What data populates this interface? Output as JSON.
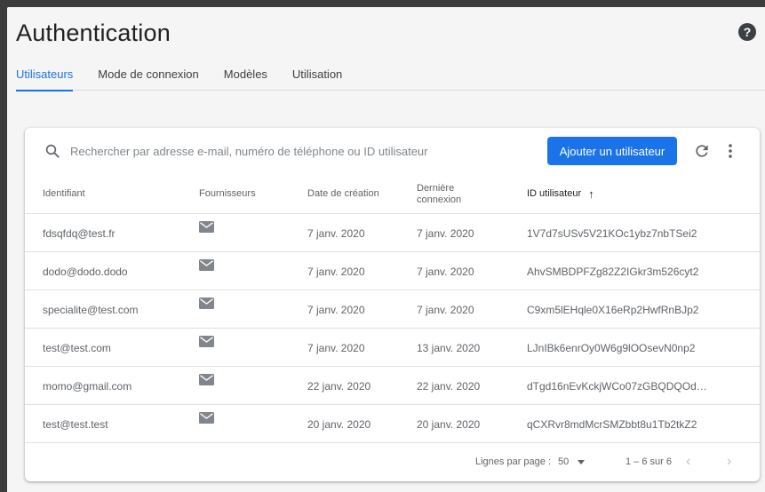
{
  "header": {
    "title": "Authentication",
    "help_icon": "?"
  },
  "tabs": [
    {
      "label": "Utilisateurs",
      "active": true
    },
    {
      "label": "Mode de connexion",
      "active": false
    },
    {
      "label": "Modèles",
      "active": false
    },
    {
      "label": "Utilisation",
      "active": false
    }
  ],
  "toolbar": {
    "search_placeholder": "Rechercher par adresse e-mail, numéro de téléphone ou ID utilisateur",
    "add_user_label": "Ajouter un utilisateur"
  },
  "table": {
    "columns": {
      "identifier": "Identifiant",
      "providers": "Fournisseurs",
      "created": "Date de création",
      "last_sign_in_1": "Dernière",
      "last_sign_in_2": "connexion",
      "uid": "ID utilisateur"
    },
    "sort_indicator": "↑",
    "rows": [
      {
        "identifier": "fdsqfdq@test.fr",
        "created": "7 janv. 2020",
        "last": "7 janv. 2020",
        "uid": "1V7d7sUSv5V21KOc1ybz7nbTSei2"
      },
      {
        "identifier": "dodo@dodo.dodo",
        "created": "7 janv. 2020",
        "last": "7 janv. 2020",
        "uid": "AhvSMBDPFZg82Z2IGkr3m526cyt2"
      },
      {
        "identifier": "specialite@test.com",
        "created": "7 janv. 2020",
        "last": "7 janv. 2020",
        "uid": "C9xm5lEHqle0X16eRp2HwfRnBJp2"
      },
      {
        "identifier": "test@test.com",
        "created": "7 janv. 2020",
        "last": "13 janv. 2020",
        "uid": "LJnIBk6enrOy0W6g9lOOsevN0np2"
      },
      {
        "identifier": "momo@gmail.com",
        "created": "22 janv. 2020",
        "last": "22 janv. 2020",
        "uid": "dTgd16nEvKckjWCo07zGBQDQOd…"
      },
      {
        "identifier": "test@test.test",
        "created": "20 janv. 2020",
        "last": "20 janv. 2020",
        "uid": "qCXRvr8mdMcrSMZbbt8u1Tb2tkZ2"
      }
    ]
  },
  "pagination": {
    "rows_label": "Lignes par page :",
    "rows_value": "50",
    "range": "1 – 6 sur 6",
    "prev": "‹",
    "next": "›"
  },
  "colors": {
    "accent": "#1a73e8",
    "background": "#f5f5f5"
  }
}
